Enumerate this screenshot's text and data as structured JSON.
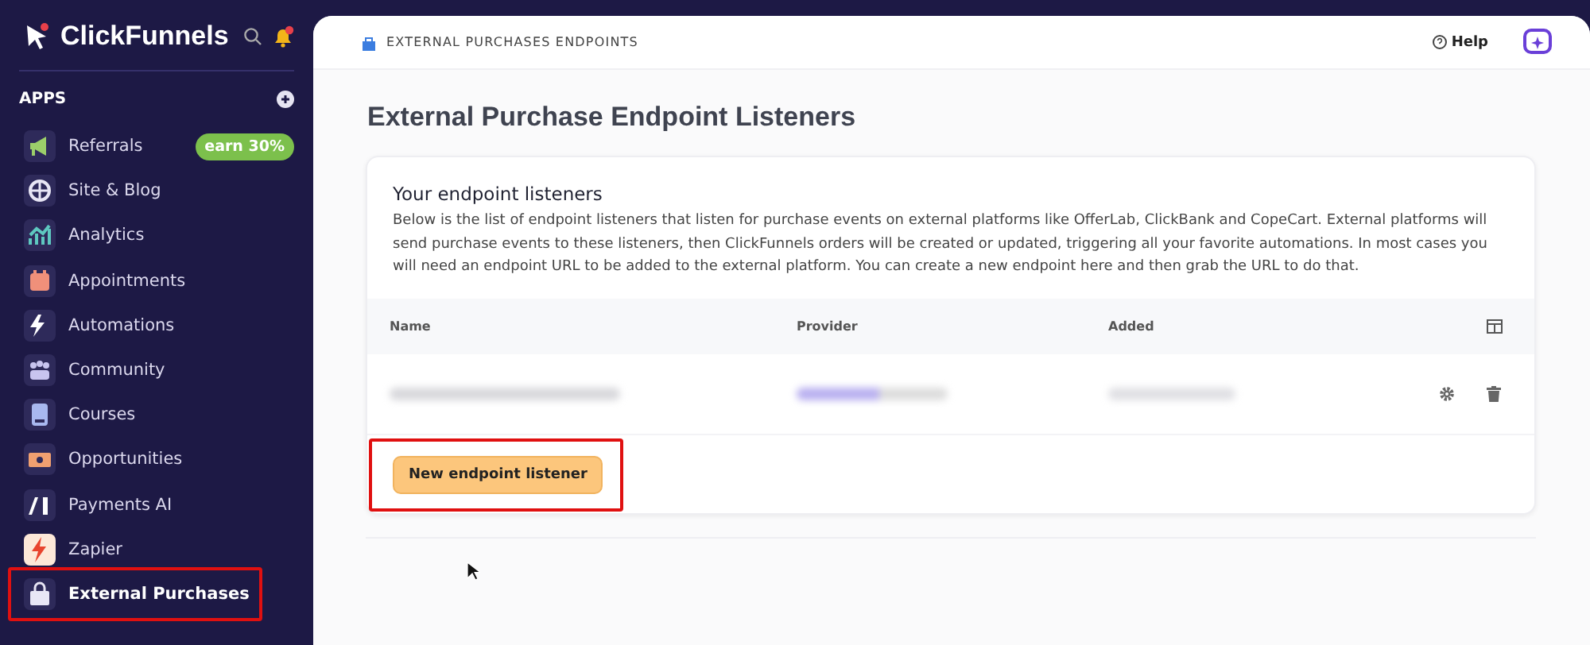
{
  "sidebar": {
    "brand": "ClickFunnels",
    "notifications": true,
    "section": "APPS",
    "items": [
      {
        "label": "Referrals",
        "badge": "earn 30%",
        "selected": false,
        "highlighted": false
      },
      {
        "label": "Site & Blog",
        "selected": false,
        "highlighted": false
      },
      {
        "label": "Analytics",
        "selected": false,
        "highlighted": false
      },
      {
        "label": "Appointments",
        "selected": false,
        "highlighted": false
      },
      {
        "label": "Automations",
        "selected": false,
        "highlighted": false
      },
      {
        "label": "Community",
        "selected": false,
        "highlighted": false
      },
      {
        "label": "Courses",
        "selected": false,
        "highlighted": false
      },
      {
        "label": "Opportunities",
        "selected": false,
        "highlighted": false
      },
      {
        "label": "Payments AI",
        "selected": false,
        "highlighted": false
      },
      {
        "label": "Zapier",
        "selected": false,
        "highlighted": false
      },
      {
        "label": "External Purchases",
        "selected": true,
        "highlighted": true
      }
    ]
  },
  "header": {
    "breadcrumb": "EXTERNAL PURCHASES ENDPOINTS",
    "help": "Help"
  },
  "page_title": "External Purchase Endpoint Listeners",
  "card": {
    "title": "Your endpoint listeners",
    "description": "Below is the list of endpoint listeners that listen for purchase events on external platforms like OfferLab, ClickBank and CopeCart. External platforms will send purchase events to these listeners, then ClickFunnels orders will be created or updated, triggering all your favorite automations. In most cases you will need an endpoint URL to be added to the external platform. You can create a new endpoint here and then grab the URL to do that.",
    "table": {
      "columns": [
        "Name",
        "Provider",
        "Added"
      ]
    },
    "button": {
      "label": "New endpoint listener",
      "highlighted": true
    }
  }
}
